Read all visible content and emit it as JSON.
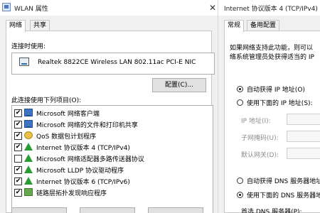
{
  "wlan": {
    "title": "WLAN 属性",
    "tabs": [
      "网络",
      "共享"
    ],
    "connect_using_label": "连接时使用:",
    "adapter_name": "Realtek 8822CE Wireless LAN 802.11ac PCI-E NIC",
    "configure_button": "配置(C)...",
    "items_label": "此连接使用下列项目(O):",
    "items": [
      {
        "label": "Microsoft 网络客户端",
        "checked": "✔",
        "icon": "network-client-icon"
      },
      {
        "label": "Microsoft 网络的文件和打印机共享",
        "checked": "✔",
        "icon": "file-share-icon"
      },
      {
        "label": "QoS 数据包计划程序",
        "checked": "✔",
        "icon": "qos-icon"
      },
      {
        "label": "Internet 协议版本 4 (TCP/IPv4)",
        "checked": "✔",
        "icon": "protocol-icon"
      },
      {
        "label": "Microsoft 网络适配器多路传送器协议",
        "checked": "",
        "icon": "protocol-icon"
      },
      {
        "label": "Microsoft LLDP 协议驱动程序",
        "checked": "✔",
        "icon": "protocol-icon"
      },
      {
        "label": "Internet 协议版本 6 (TCP/IPv6)",
        "checked": "✔",
        "icon": "protocol-icon"
      },
      {
        "label": "链路层拓扑发现响应程序",
        "checked": "✔",
        "icon": "link-layer-icon"
      }
    ]
  },
  "ipv4": {
    "title": "Internet 协议版本 4 (TCP/IPv4)",
    "tabs": [
      "常规",
      "备用配置"
    ],
    "description_line1": "如果网络支持此功能，则可以",
    "description_line2": "络系统管理员处获得适当的 IP",
    "auto_ip": "自动获得 IP 地址(O)",
    "manual_ip": "使用下面的 IP 地址(S):",
    "ip_address_label": "IP 地址(I):",
    "subnet_label": "子网掩码(U):",
    "gateway_label": "默认网关(D):",
    "auto_dns": "自动获得 DNS 服务器地址",
    "manual_dns": "使用下面的 DNS 服务器地",
    "preferred_dns_label": "首选 DNS 服务器(P):"
  },
  "colors": {
    "window_bg": "#f0f0f0",
    "panel_bg": "#ffffff",
    "border": "#adadad"
  }
}
